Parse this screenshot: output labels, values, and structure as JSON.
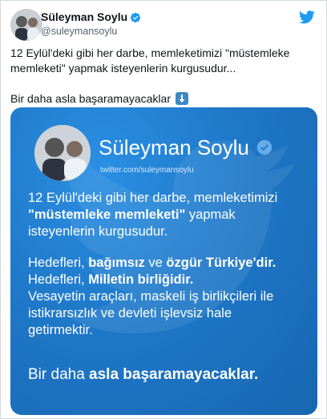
{
  "author": {
    "display_name": "Süleyman Soylu",
    "handle": "@suleymansoylu"
  },
  "tweet": {
    "line1": "12 Eylül'deki gibi her darbe, memleketimizi \"müstemleke",
    "line2": "memleketi\" yapmak isteyenlerin kurgusudur...",
    "line3": "Bir daha asla başaramayacaklar",
    "emoji": "down-arrow-emoji"
  },
  "card": {
    "name": "Süleyman Soylu",
    "url": "twitter.com/suleymansoylu",
    "p1_l1": "12 Eylül'deki gibi her darbe, memleketimizi",
    "p1_l2_bold": "\"müstemleke memleketi\"",
    "p1_l2_rest": " yapmak",
    "p1_l3": "isteyenlerin kurgusudur.",
    "p2_l1_a": "Hedefleri, ",
    "p2_l1_b": "bağımsız",
    "p2_l1_c": " ve ",
    "p2_l1_d": "özgür Türkiye'dir.",
    "p2_l2_a": "Hedefleri, ",
    "p2_l2_b": "Milletin birliğidir.",
    "p2_l3": "Vesayetin araçları, maskeli iş birlikçileri ile",
    "p2_l4": "istikrarsızlık ve devleti işlevsiz hale",
    "p2_l5": "getirmektir.",
    "closing_a": "Bir daha ",
    "closing_b": "asla başaramayacaklar."
  },
  "colors": {
    "verified": "#1d9bf0",
    "twitter_blue": "#1d9bf0",
    "card_background": "#1f78c8"
  },
  "icons": [
    "verified-badge-icon",
    "twitter-bird-icon",
    "down-arrow-emoji"
  ]
}
